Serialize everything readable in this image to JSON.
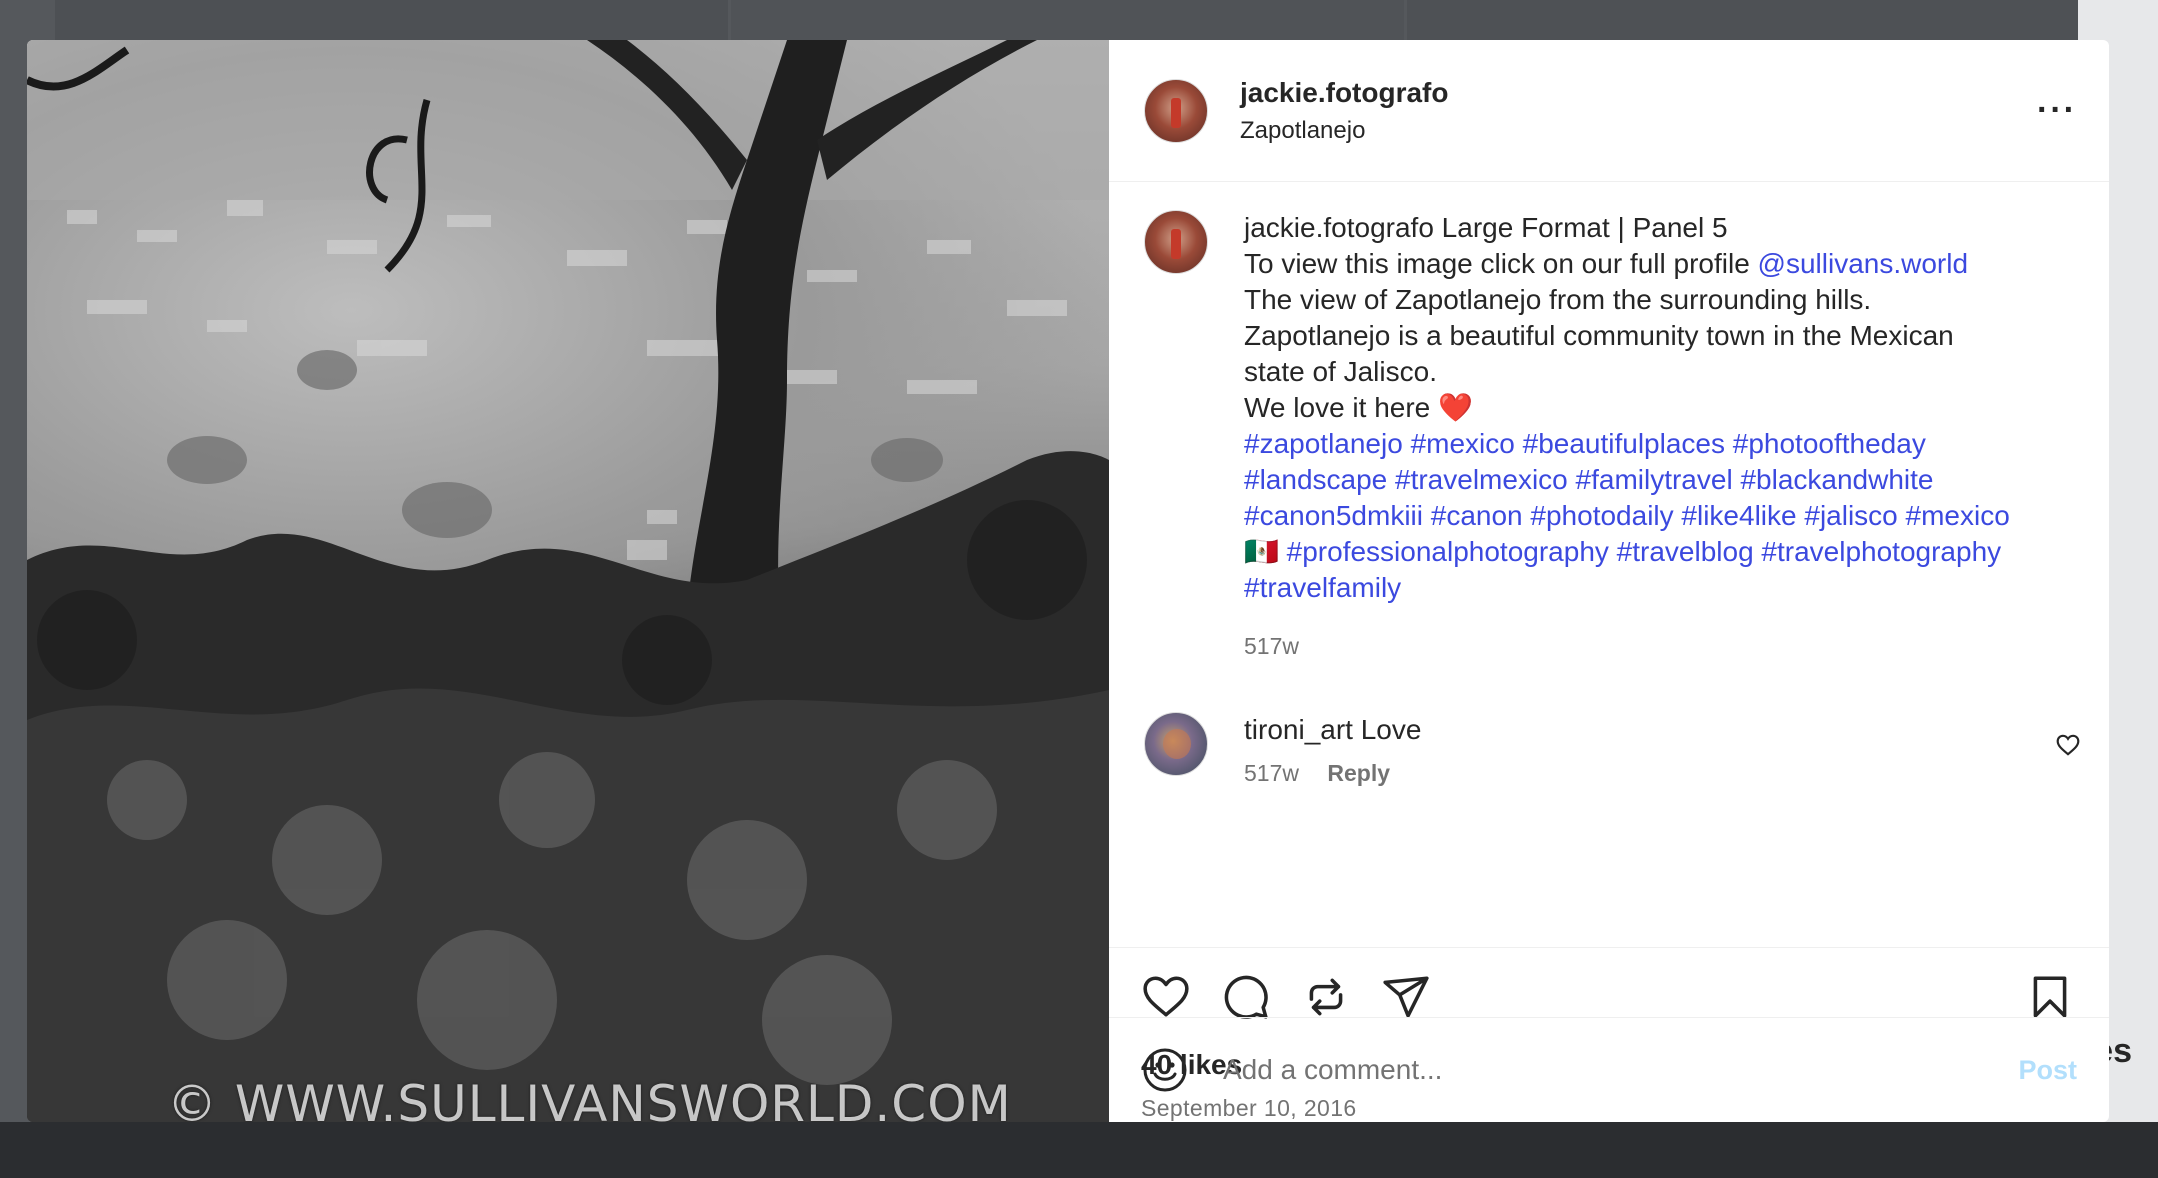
{
  "background": {
    "peek_text": "es"
  },
  "photo": {
    "watermark": "© WWW.SULLIVANSWORLD.COM"
  },
  "post": {
    "username": "jackie.fotografo",
    "location": "Zapotlanejo",
    "more_icon": "ellipsis-icon",
    "caption": {
      "username": "jackie.fotografo",
      "lines": [
        "Large Format | Panel 5",
        "To view this image click on our full profile ",
        "The view of Zapotlanejo from the surrounding hills.",
        "Zapotlanejo is a beautiful community town in the Mexican",
        "state of Jalisco.",
        "We love it here"
      ],
      "mention": "@sullivans.world",
      "heart_emoji": "❤️",
      "hashtags_lines": [
        "#zapotlanejo #mexico #beautifulplaces #photooftheday",
        "#landscape #travelmexico #familytravel #blackandwhite",
        "#canon5dmkiii #canon #photodaily #like4like #jalisco #mexico",
        "#professionalphotography #travelblog #travelphotography",
        "#travelfamily"
      ],
      "flag_emoji": "🇲🇽",
      "time": "517w"
    },
    "comments": [
      {
        "username": "tironi_art",
        "text": "Love",
        "time": "517w",
        "reply_label": "Reply"
      }
    ],
    "likes": "40 likes",
    "date": "September 10, 2016",
    "add_comment": {
      "placeholder": "Add a comment...",
      "post_label": "Post"
    }
  },
  "colors": {
    "link": "#3b49df",
    "post_disabled": "#b2dffc",
    "muted": "#737373"
  }
}
